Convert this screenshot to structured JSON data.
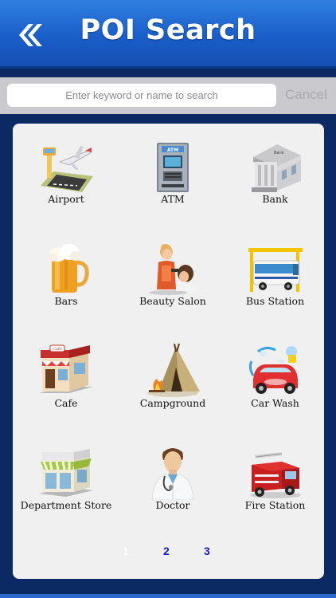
{
  "header": {
    "title": "POI Search",
    "back_icon": "double-chevron-left-icon"
  },
  "search": {
    "placeholder": "Enter keyword or name to search",
    "value": "",
    "cancel_label": "Cancel"
  },
  "categories": [
    {
      "label": "Airport",
      "icon": "airport-icon"
    },
    {
      "label": "ATM",
      "icon": "atm-icon"
    },
    {
      "label": "Bank",
      "icon": "bank-icon"
    },
    {
      "label": "Bars",
      "icon": "beer-icon"
    },
    {
      "label": "Beauty Salon",
      "icon": "beauty-salon-icon"
    },
    {
      "label": "Bus Station",
      "icon": "bus-station-icon"
    },
    {
      "label": "Cafe",
      "icon": "cafe-icon"
    },
    {
      "label": "Campground",
      "icon": "campground-icon"
    },
    {
      "label": "Car Wash",
      "icon": "car-wash-icon"
    },
    {
      "label": "Department Store",
      "icon": "department-store-icon"
    },
    {
      "label": "Doctor",
      "icon": "doctor-icon"
    },
    {
      "label": "Fire Station",
      "icon": "fire-truck-icon"
    }
  ],
  "pagination": {
    "pages": [
      "1",
      "2",
      "3"
    ],
    "current": "1"
  },
  "colors": {
    "background": "#0b2a63",
    "header": "#1a5ec9",
    "active_page": "#ffffff",
    "page_link": "#1818c8"
  }
}
